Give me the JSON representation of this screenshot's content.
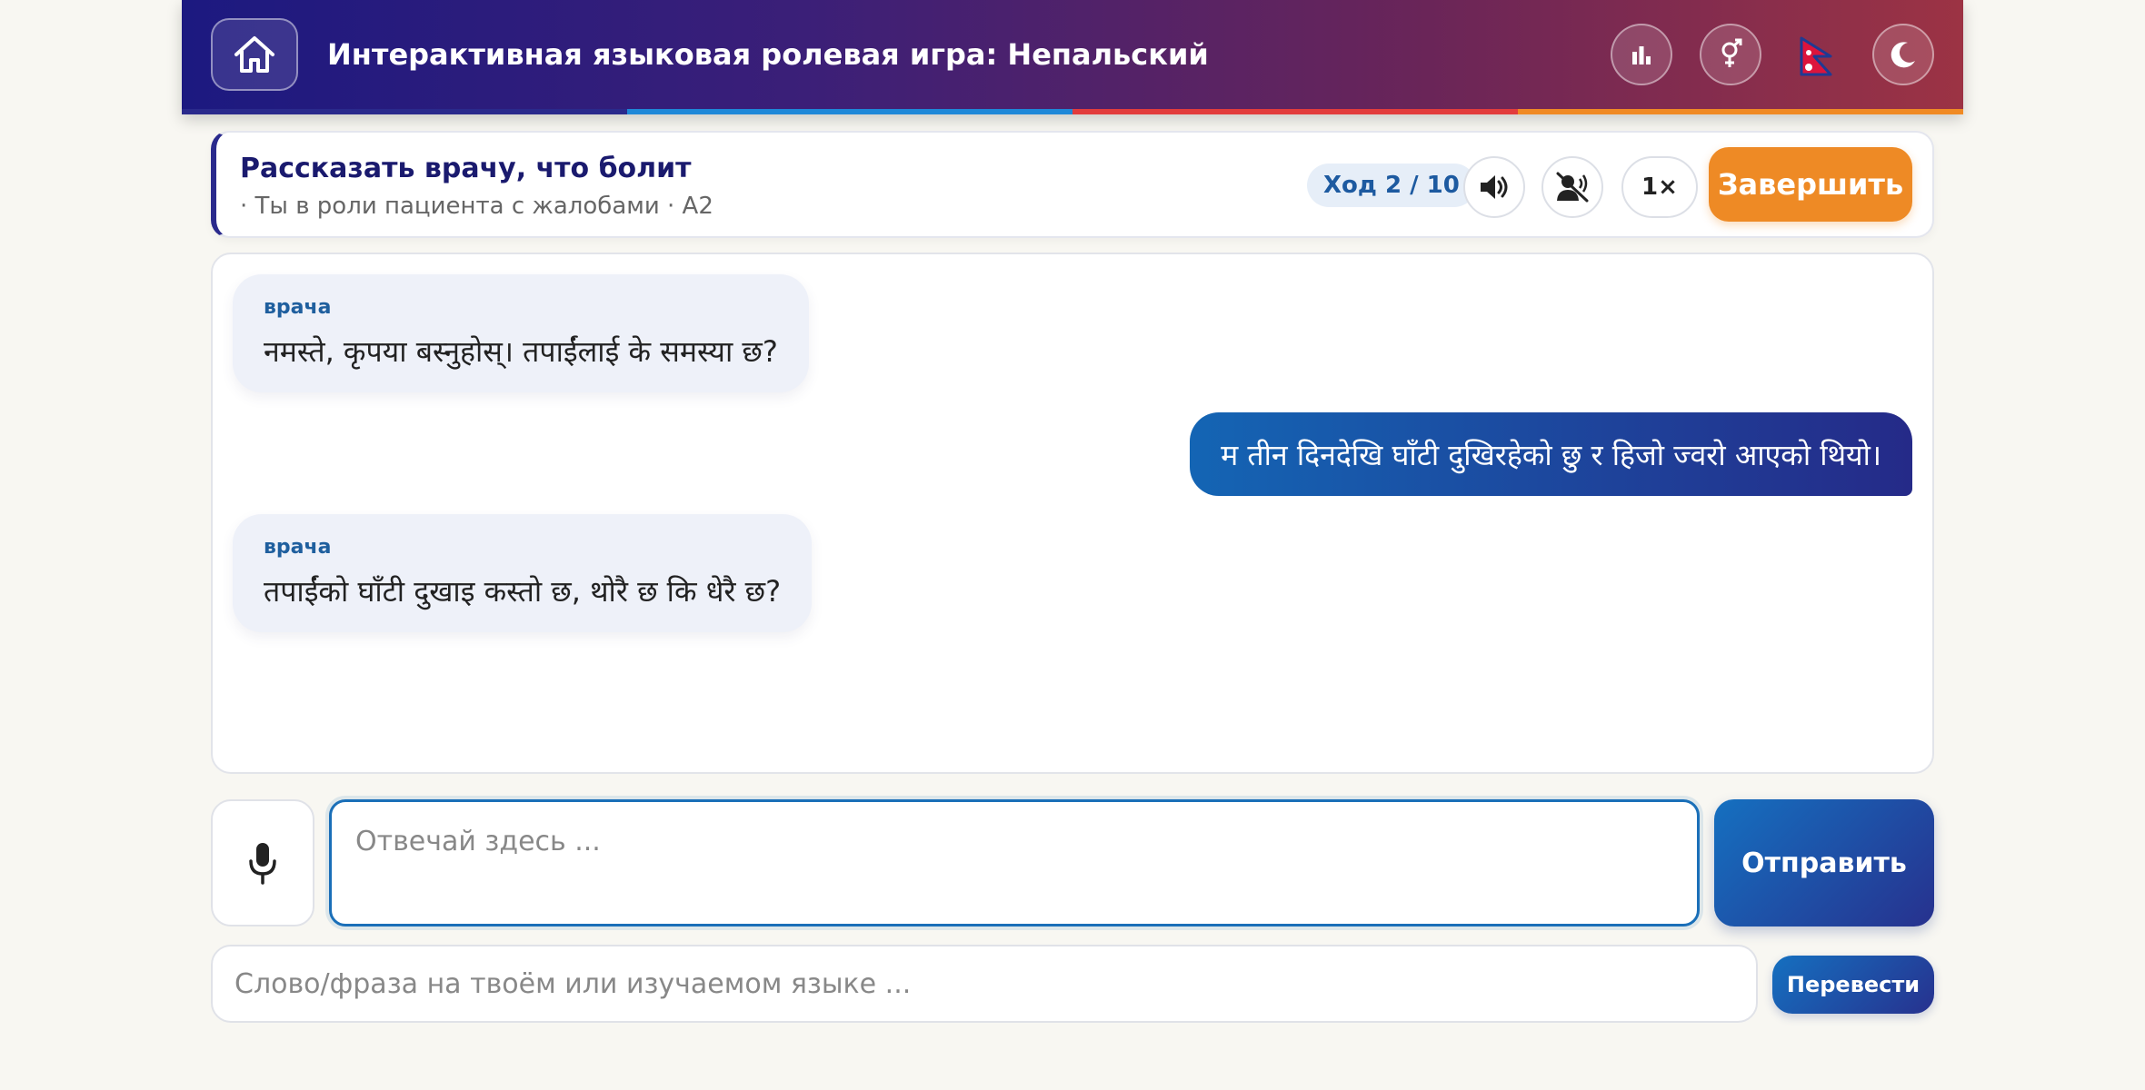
{
  "header": {
    "title": "Интерактивная языковая ролевая игра: Непальский",
    "icons": [
      "home-icon",
      "stats-icon",
      "gender-icon",
      "nepal-flag-icon",
      "moon-icon"
    ],
    "stripe_colors": [
      "#2a2a8c",
      "#1e88d8",
      "#e23c3c",
      "#f08a24"
    ]
  },
  "scenario": {
    "title": "Рассказать врачу, что болит",
    "subtitle": "· Ты в роли пациента с жалобами · A2",
    "turn": "Ход 2 / 10",
    "speed": "1×",
    "finish_label": "Завершить"
  },
  "chat": {
    "messages": [
      {
        "role": "bot",
        "speaker": "врача",
        "text": "नमस्ते, कृपया बस्नुहोस्। तपाईंलाई के समस्या छ?"
      },
      {
        "role": "user",
        "text": "म तीन दिनदेखि घाँटी दुखिरहेको छु र हिजो ज्वरो आएको थियो।"
      },
      {
        "role": "bot",
        "speaker": "врача",
        "text": "तपाईंको घाँटी दुखाइ कस्तो छ, थोरै छ कि धेरै छ?"
      }
    ]
  },
  "input": {
    "placeholder": "Отвечай здесь ...",
    "send_label": "Отправить"
  },
  "translate": {
    "placeholder": "Слово/фраза на твоём или изучаемом языке ...",
    "button_label": "Перевести"
  },
  "colors": {
    "accent": "#1a6fb8",
    "finish": "#ee8a25",
    "header_start": "#1c1980",
    "header_end": "#9c3344"
  }
}
